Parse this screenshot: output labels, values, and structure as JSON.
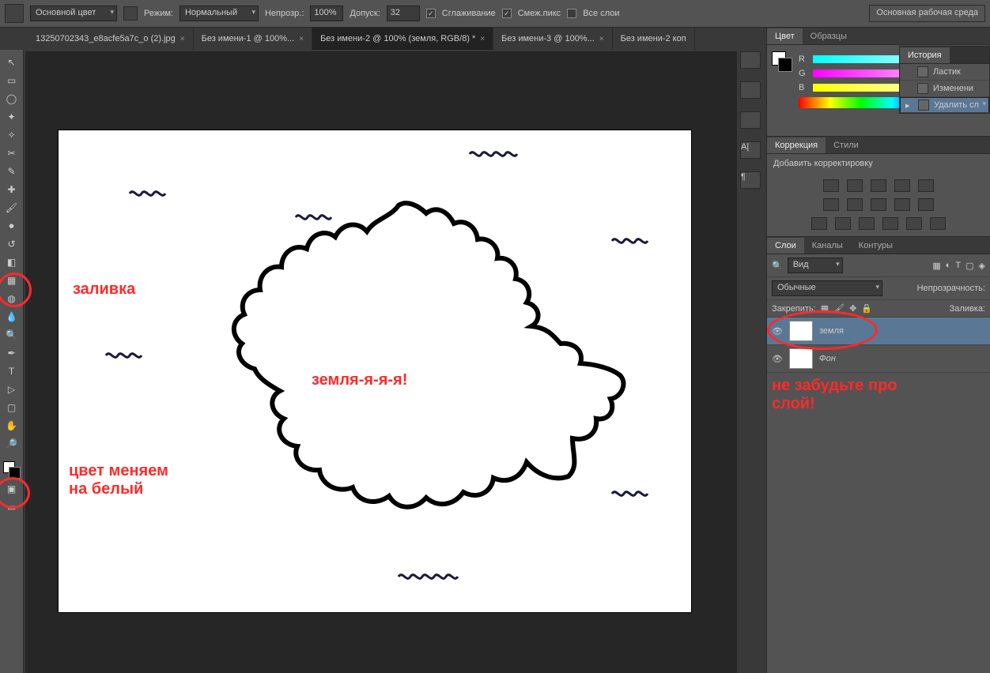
{
  "options_bar": {
    "fill_mode_label": "Основной цвет",
    "mode_label": "Режим:",
    "mode_value": "Нормальный",
    "opacity_label": "Непрозр.:",
    "opacity_value": "100%",
    "tolerance_label": "Допуск:",
    "tolerance_value": "32",
    "antialias_label": "Сглаживание",
    "contiguous_label": "Смеж.пикс",
    "all_layers_label": "Все слои",
    "antialias_checked": true,
    "contiguous_checked": true,
    "all_layers_checked": false,
    "workspace_button": "Основная рабочая среда"
  },
  "tabs": [
    {
      "label": "13250702343_e8acfe5a7c_o (2).jpg",
      "active": false,
      "closable": true
    },
    {
      "label": "Без имени-1 @ 100%...",
      "active": false,
      "closable": true
    },
    {
      "label": "Без имени-2 @ 100% (земля, RGB/8) *",
      "active": true,
      "closable": true
    },
    {
      "label": "Без имени-3 @ 100%...",
      "active": false,
      "closable": true
    },
    {
      "label": "Без имени-2 коп",
      "active": false,
      "closable": false
    }
  ],
  "tabs_overflow": "»",
  "annotations": {
    "fill": "заливка",
    "color": "цвет меняем\nна белый",
    "earth": "земля-я-я-я!",
    "layer": "не забудьте про\nслой!"
  },
  "color_panel": {
    "tab_color": "Цвет",
    "tab_swatches": "Образцы",
    "channels": [
      "R",
      "G",
      "B"
    ]
  },
  "history_panel": {
    "title": "История",
    "items": [
      {
        "label": "Ластик",
        "selected": false
      },
      {
        "label": "Изменени",
        "selected": false
      },
      {
        "label": "Удалить сл",
        "selected": true
      }
    ]
  },
  "adjust_panel": {
    "tab_correction": "Коррекция",
    "tab_styles": "Стили",
    "add_label": "Добавить корректировку"
  },
  "layers_panel": {
    "tab_layers": "Слои",
    "tab_channels": "Каналы",
    "tab_paths": "Контуры",
    "filter_label": "Вид",
    "blend_mode": "Обычные",
    "opacity_label": "Непрозрачность:",
    "lock_label": "Закрепить:",
    "fill_label": "Заливка:",
    "layers": [
      {
        "name": "земля",
        "active": true
      },
      {
        "name": "Фон",
        "active": false
      }
    ]
  }
}
